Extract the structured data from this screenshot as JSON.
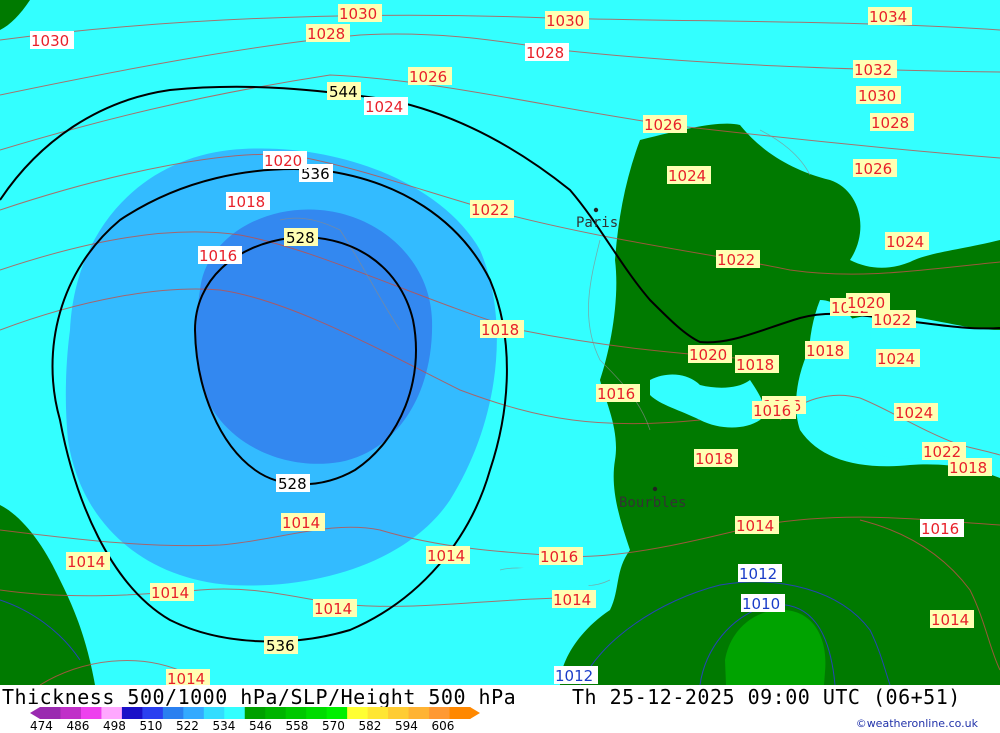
{
  "header": {
    "title_left": "Thickness 500/1000 hPa/SLP/Height 500 hPa",
    "title_right": "Th 25-12-2025 09:00 UTC (06+51)"
  },
  "credit": "©weatheronline.co.uk",
  "colors": {
    "cyan_fill": "#33ffff",
    "light_blue_fill": "#33bbff",
    "mid_blue_fill": "#3388f0",
    "green_fill": "#007a00",
    "bright_green_fill": "#00a300",
    "slp_label_text_red": "#e8202a",
    "slp_label_text_blue": "#1a3cc8",
    "height_contour": "#000000"
  },
  "scale": {
    "labels": [
      "474",
      "486",
      "498",
      "510",
      "522",
      "534",
      "546",
      "558",
      "570",
      "582",
      "594",
      "606"
    ],
    "colors": [
      "#9a2ab0",
      "#c030c8",
      "#ee40ee",
      "#ffa8ff",
      "#1a10c8",
      "#2a40f0",
      "#2a80f0",
      "#33aaff",
      "#33ddff",
      "#33ffff",
      "#00a000",
      "#00b400",
      "#00c800",
      "#00dc00",
      "#00f000",
      "#ffff33",
      "#ffe633",
      "#ffcc33",
      "#ffb333",
      "#ff9933",
      "#ff8800"
    ]
  },
  "map": {
    "cities": [
      {
        "name": "Paris"
      },
      {
        "name": "Bourbles"
      }
    ],
    "height_labels": [
      "544",
      "536",
      "528",
      "528",
      "536"
    ],
    "slp_labels_red": [
      "1030",
      "1030",
      "1030",
      "1030",
      "1028",
      "1028",
      "1026",
      "1024",
      "1026",
      "1020",
      "1018",
      "1016",
      "1022",
      "1018",
      "1016",
      "1024",
      "1022",
      "1020",
      "1018",
      "1018",
      "1016",
      "1014",
      "1014",
      "1014",
      "1014",
      "1014",
      "1014",
      "1014",
      "1016",
      "1014",
      "1032",
      "1030",
      "1028",
      "1026",
      "1024",
      "1034",
      "1022",
      "1020",
      "1022",
      "1018",
      "1024",
      "1024",
      "1022",
      "1018",
      "1016",
      "1014",
      "1016",
      "1014"
    ],
    "slp_labels_blue": [
      "1012",
      "1010",
      "1012"
    ]
  }
}
